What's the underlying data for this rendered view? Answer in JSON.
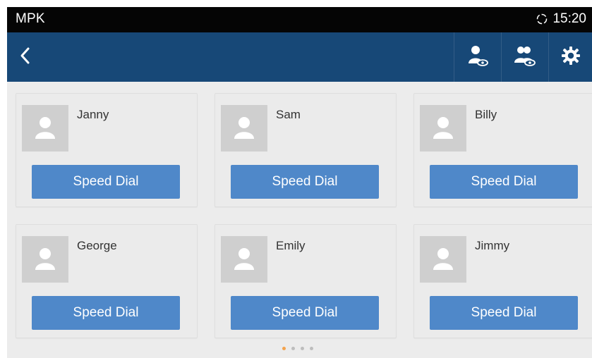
{
  "status_bar": {
    "app_label": "MPK",
    "time": "15:20",
    "sync_icon": "sync-icon"
  },
  "top_bar": {
    "back_icon": "chevron-left-icon",
    "actions": [
      {
        "icon": "contact-view-icon"
      },
      {
        "icon": "group-view-icon"
      },
      {
        "icon": "gear-icon"
      }
    ]
  },
  "contacts": [
    {
      "name": "Janny",
      "button_label": "Speed Dial"
    },
    {
      "name": "Sam",
      "button_label": "Speed Dial"
    },
    {
      "name": "Billy",
      "button_label": "Speed Dial"
    },
    {
      "name": "George",
      "button_label": "Speed Dial"
    },
    {
      "name": "Emily",
      "button_label": "Speed Dial"
    },
    {
      "name": "Jimmy",
      "button_label": "Speed Dial"
    }
  ],
  "pagination": {
    "current_page": 1,
    "page_count": 4
  },
  "colors": {
    "status_bar_bg": "#050505",
    "top_bar_bg": "#174877",
    "button_bg": "#4f88c9",
    "screen_bg": "#ececec",
    "active_page_dot": "#f4a34d"
  }
}
